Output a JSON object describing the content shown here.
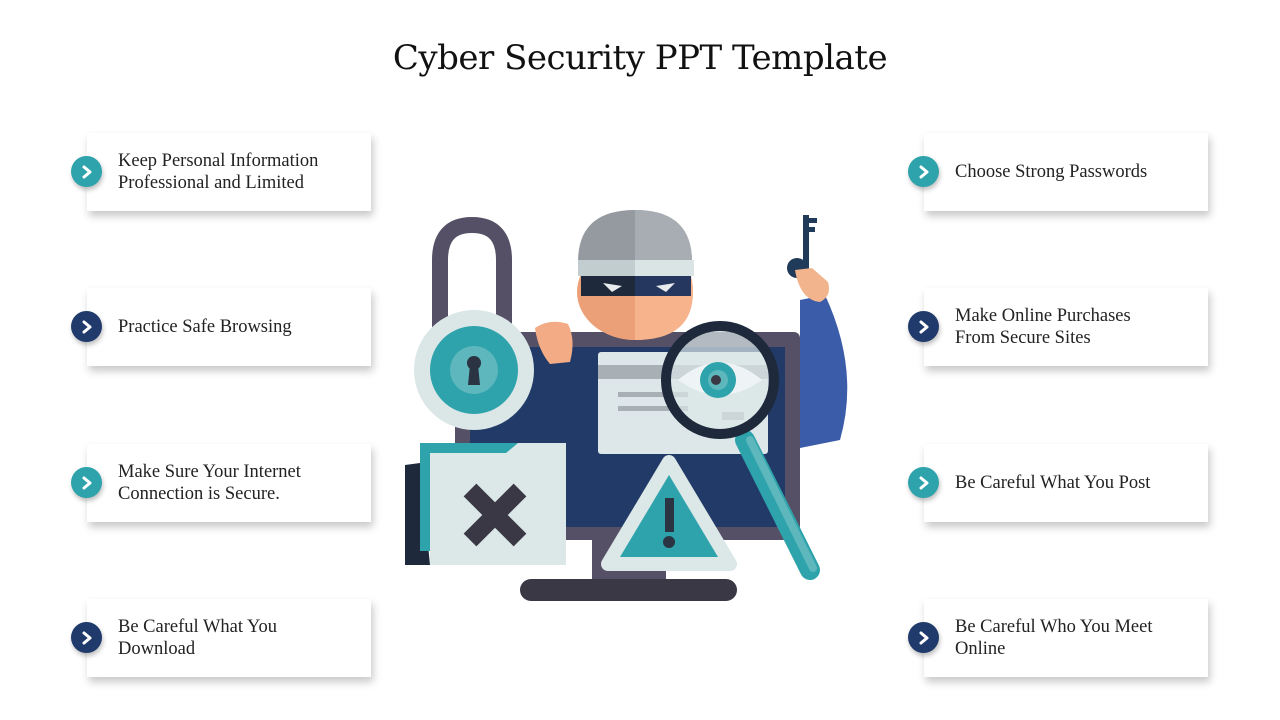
{
  "slide": {
    "title": "Cyber Security PPT Template"
  },
  "colors": {
    "teal": "#2ea3ab",
    "navy": "#203a6b"
  },
  "left_items": [
    {
      "text": "Keep Personal Information\nProfessional and Limited",
      "bullet": "teal",
      "icon": "chevron-right-icon"
    },
    {
      "text": "Practice Safe Browsing",
      "bullet": "navy",
      "icon": "chevron-right-icon"
    },
    {
      "text": "Make Sure Your Internet\nConnection is Secure.",
      "bullet": "teal",
      "icon": "chevron-right-icon"
    },
    {
      "text": "Be Careful What You\nDownload",
      "bullet": "navy",
      "icon": "chevron-right-icon"
    }
  ],
  "right_items": [
    {
      "text": "Choose Strong Passwords",
      "bullet": "teal",
      "icon": "chevron-right-icon"
    },
    {
      "text": "Make Online Purchases\nFrom Secure Sites",
      "bullet": "navy",
      "icon": "chevron-right-icon"
    },
    {
      "text": "Be Careful What You Post",
      "bullet": "teal",
      "icon": "chevron-right-icon"
    },
    {
      "text": "Be Careful Who You Meet\nOnline",
      "bullet": "navy",
      "icon": "chevron-right-icon"
    }
  ],
  "illustration": {
    "description": "Hacker with mask behind monitor, padlock, folder with X, warning sign, magnifying glass with eye, key",
    "icons": [
      "hacker-icon",
      "padlock-icon",
      "monitor-icon",
      "folder-x-icon",
      "warning-icon",
      "magnifier-eye-icon",
      "key-icon"
    ]
  }
}
